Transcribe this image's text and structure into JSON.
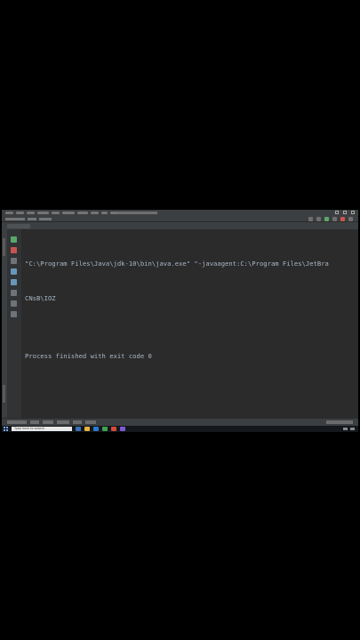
{
  "console": {
    "lines": [
      "\"C:\\Program Files\\Java\\jdk-10\\bin\\java.exe\" \"-javaagent:C:\\Program Files\\JetBra",
      "CNsB\\IOZ",
      "",
      "Process finished with exit code 0"
    ]
  },
  "taskbar": {
    "search_placeholder": "Type here to search"
  },
  "colors": {
    "background": "#000000",
    "editor_bg": "#2b2b2b",
    "console_text": "#a9b7c6",
    "chrome": "#3c3f41"
  },
  "icons": {
    "gutter": [
      "rerun-icon",
      "stop-icon",
      "pause-icon",
      "up-icon",
      "down-icon",
      "wrap-icon",
      "print-icon",
      "trash-icon"
    ]
  }
}
